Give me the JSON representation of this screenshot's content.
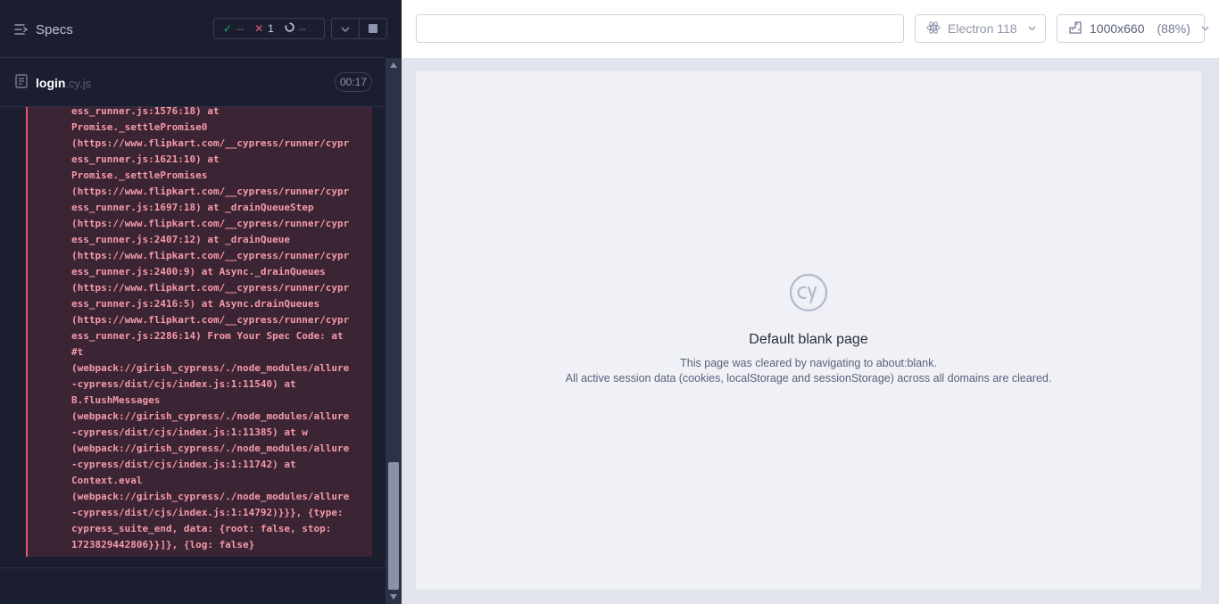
{
  "reporter": {
    "specs_label": "Specs",
    "stats": {
      "passed": "--",
      "failed": "1",
      "pending": "--"
    },
    "spec": {
      "name": "login",
      "ext": ".cy.js",
      "duration": "00:17"
    },
    "log_lines": [
      "ess_runner.js:1576:18) at",
      "Promise._settlePromise0",
      "(https://www.flipkart.com/__cypress/runner/cypr",
      "ess_runner.js:1621:10) at",
      "Promise._settlePromises",
      "(https://www.flipkart.com/__cypress/runner/cypr",
      "ess_runner.js:1697:18) at _drainQueueStep",
      "(https://www.flipkart.com/__cypress/runner/cypr",
      "ess_runner.js:2407:12) at _drainQueue",
      "(https://www.flipkart.com/__cypress/runner/cypr",
      "ess_runner.js:2400:9) at Async._drainQueues",
      "(https://www.flipkart.com/__cypress/runner/cypr",
      "ess_runner.js:2416:5) at Async.drainQueues",
      "(https://www.flipkart.com/__cypress/runner/cypr",
      "ess_runner.js:2286:14) From Your Spec Code: at",
      "#t",
      "(webpack://girish_cypress/./node_modules/allure",
      "-cypress/dist/cjs/index.js:1:11540) at",
      "B.flushMessages",
      "(webpack://girish_cypress/./node_modules/allure",
      "-cypress/dist/cjs/index.js:1:11385) at w",
      "(webpack://girish_cypress/./node_modules/allure",
      "-cypress/dist/cjs/index.js:1:11742) at",
      "Context.eval",
      "(webpack://girish_cypress/./node_modules/allure",
      "-cypress/dist/cjs/index.js:1:14792)}}}, {type:",
      "cypress_suite_end, data: {root: false, stop:",
      "1723829442806}}]}, {log: false}"
    ]
  },
  "topbar": {
    "url_value": "",
    "browser_label": "Electron 118",
    "viewport_size": "1000x660",
    "viewport_scale": "(88%)"
  },
  "aut": {
    "title": "Default blank page",
    "line1": "This page was cleared by navigating to about:blank.",
    "line2": "All active session data (cookies, localStorage and sessionStorage) across all domains are cleared."
  },
  "colors": {
    "reporter_bg": "#1b1e2e",
    "error_bg": "#3b2434",
    "error_text": "#f59aa9",
    "fail_accent": "#e45770",
    "pass_accent": "#1fa971"
  }
}
